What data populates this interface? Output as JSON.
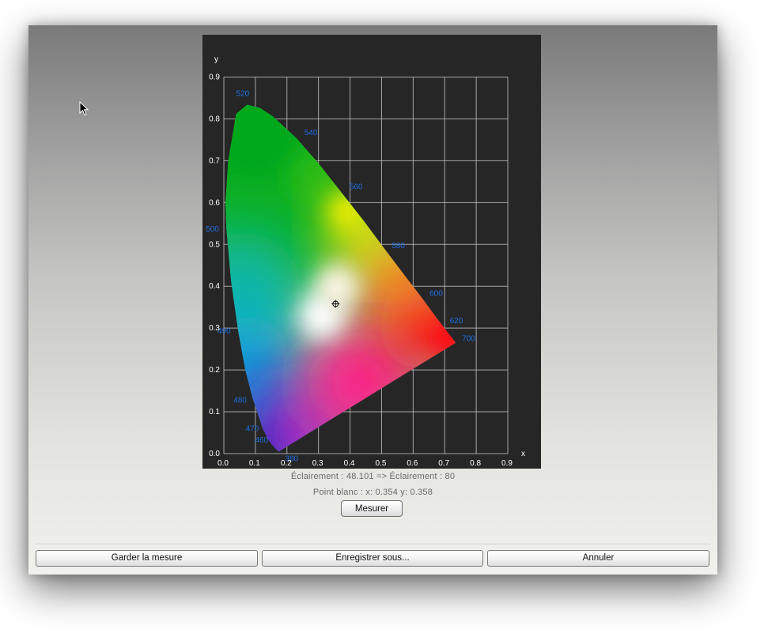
{
  "chart_data": {
    "type": "scatter",
    "title": "",
    "xlabel": "x",
    "ylabel": "y",
    "xlim": [
      0,
      0.9
    ],
    "ylim": [
      0,
      0.9
    ],
    "grid": true,
    "x_ticks": [
      "0.0",
      "0.1",
      "0.2",
      "0.3",
      "0.4",
      "0.5",
      "0.6",
      "0.7",
      "0.8",
      "0.9"
    ],
    "y_ticks": [
      "0.0",
      "0.1",
      "0.2",
      "0.3",
      "0.4",
      "0.5",
      "0.6",
      "0.7",
      "0.8",
      "0.9"
    ],
    "locus_points": [
      {
        "label": "380",
        "x": 0.174,
        "y": 0.005
      },
      {
        "label": "460",
        "x": 0.144,
        "y": 0.03
      },
      {
        "label": "470",
        "x": 0.124,
        "y": 0.058
      },
      {
        "label": "480",
        "x": 0.091,
        "y": 0.133
      },
      {
        "label": "490",
        "x": 0.045,
        "y": 0.295
      },
      {
        "label": "500",
        "x": 0.008,
        "y": 0.538
      },
      {
        "label": "520",
        "x": 0.074,
        "y": 0.834
      },
      {
        "label": "540",
        "x": 0.23,
        "y": 0.754
      },
      {
        "label": "560",
        "x": 0.373,
        "y": 0.624
      },
      {
        "label": "580",
        "x": 0.512,
        "y": 0.487
      },
      {
        "label": "600",
        "x": 0.627,
        "y": 0.373
      },
      {
        "label": "620",
        "x": 0.691,
        "y": 0.308
      },
      {
        "label": "700",
        "x": 0.735,
        "y": 0.265
      }
    ],
    "white_point": {
      "x": 0.354,
      "y": 0.358
    }
  },
  "info": {
    "illuminance_line": "Éclairement : 48.101 =>  Éclairement : 80",
    "white_point_line": "Point blanc : x: 0.354  y: 0.358"
  },
  "buttons": {
    "measure": "Mesurer",
    "keep": "Garder la mesure",
    "save_as": "Enregistrer sous...",
    "cancel": "Annuler"
  },
  "colors": {
    "chart_background": "#262626",
    "grid": "#bdbdbd",
    "wavelength_label": "#1e6ee0"
  }
}
